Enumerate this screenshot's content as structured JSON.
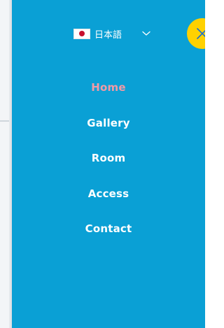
{
  "language": {
    "label": "日本語",
    "flag": "japan-flag-icon"
  },
  "nav": {
    "items": [
      {
        "label": "Home",
        "active": true
      },
      {
        "label": "Gallery",
        "active": false
      },
      {
        "label": "Room",
        "active": false
      },
      {
        "label": "Access",
        "active": false
      },
      {
        "label": "Contact",
        "active": false
      }
    ]
  },
  "colors": {
    "panel": "#0aa0d5",
    "close_button": "#ffd100",
    "active_link": "#f29aa6",
    "link": "#ffffff"
  }
}
